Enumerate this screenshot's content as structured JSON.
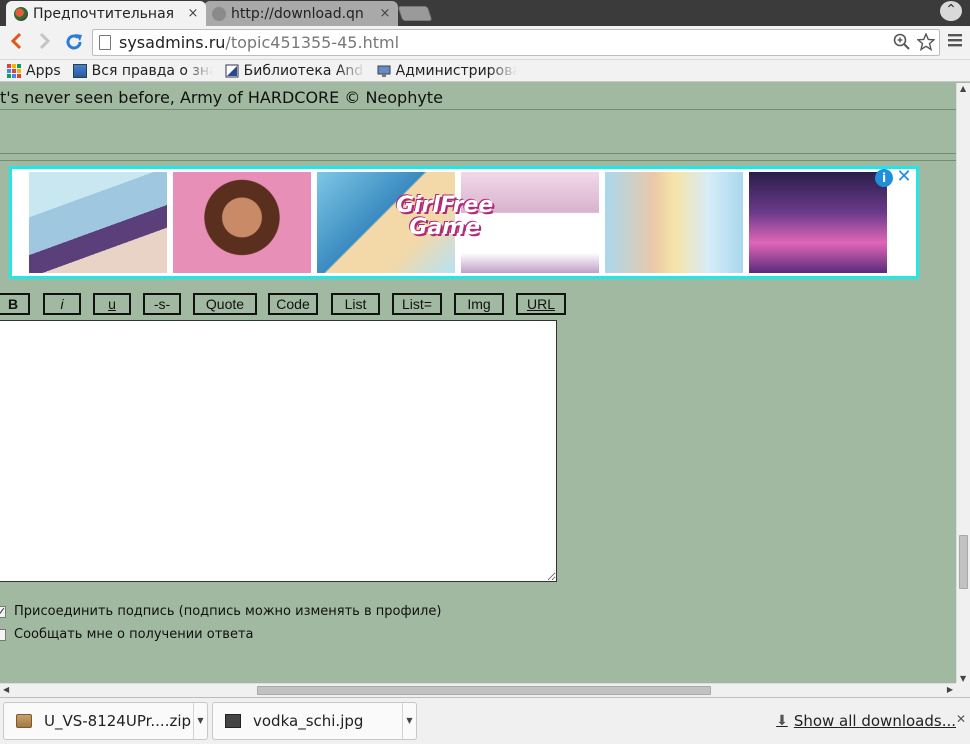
{
  "browser": {
    "tabs": [
      {
        "title": "Предпочтительная",
        "active": true
      },
      {
        "title": "http://download.qn",
        "active": false
      }
    ],
    "tab_close_glyph": "×",
    "window_control_glyph": "⌃",
    "url": {
      "host": "sysadmins.ru",
      "path": "/topic451355-45.html"
    },
    "bookmarks": [
      {
        "label": "Apps",
        "icon": "apps-grid-icon"
      },
      {
        "label": "Вся правда о зна",
        "icon": "bookmark-page-icon"
      },
      {
        "label": "Библиотека And",
        "icon": "library-icon"
      },
      {
        "label": "Администрирова",
        "icon": "admin-monitor-icon"
      }
    ]
  },
  "page": {
    "banner_text": "t's never seen before, Army of HARDCORE © Neophyte",
    "ad": {
      "logo_line1": "GirlFree",
      "logo_line2": "Game",
      "info_glyph": "i",
      "close_glyph": "✕"
    },
    "bbcode_buttons": [
      "B",
      "i",
      "u",
      "-s-",
      "Quote",
      "Code",
      "List",
      "List=",
      "Img",
      "URL"
    ],
    "message_value": "",
    "options": [
      {
        "label": "Присоединить подпись (подпись можно изменять в профиле)",
        "checked": true
      },
      {
        "label": "Сообщать мне о получении ответа",
        "checked": false
      }
    ]
  },
  "downloads": {
    "items": [
      {
        "name": "U_VS-8124UPr....zip",
        "icon": "zip-file-icon"
      },
      {
        "name": "vodka_schi.jpg",
        "icon": "image-file-icon"
      }
    ],
    "show_all_label": "Show all downloads...",
    "close_glyph": "✕"
  },
  "colors": {
    "page_bg": "#a0b9a0",
    "ad_border": "#20e8e8",
    "back_arrow": "#e0561b",
    "reload": "#2c7bd6"
  }
}
